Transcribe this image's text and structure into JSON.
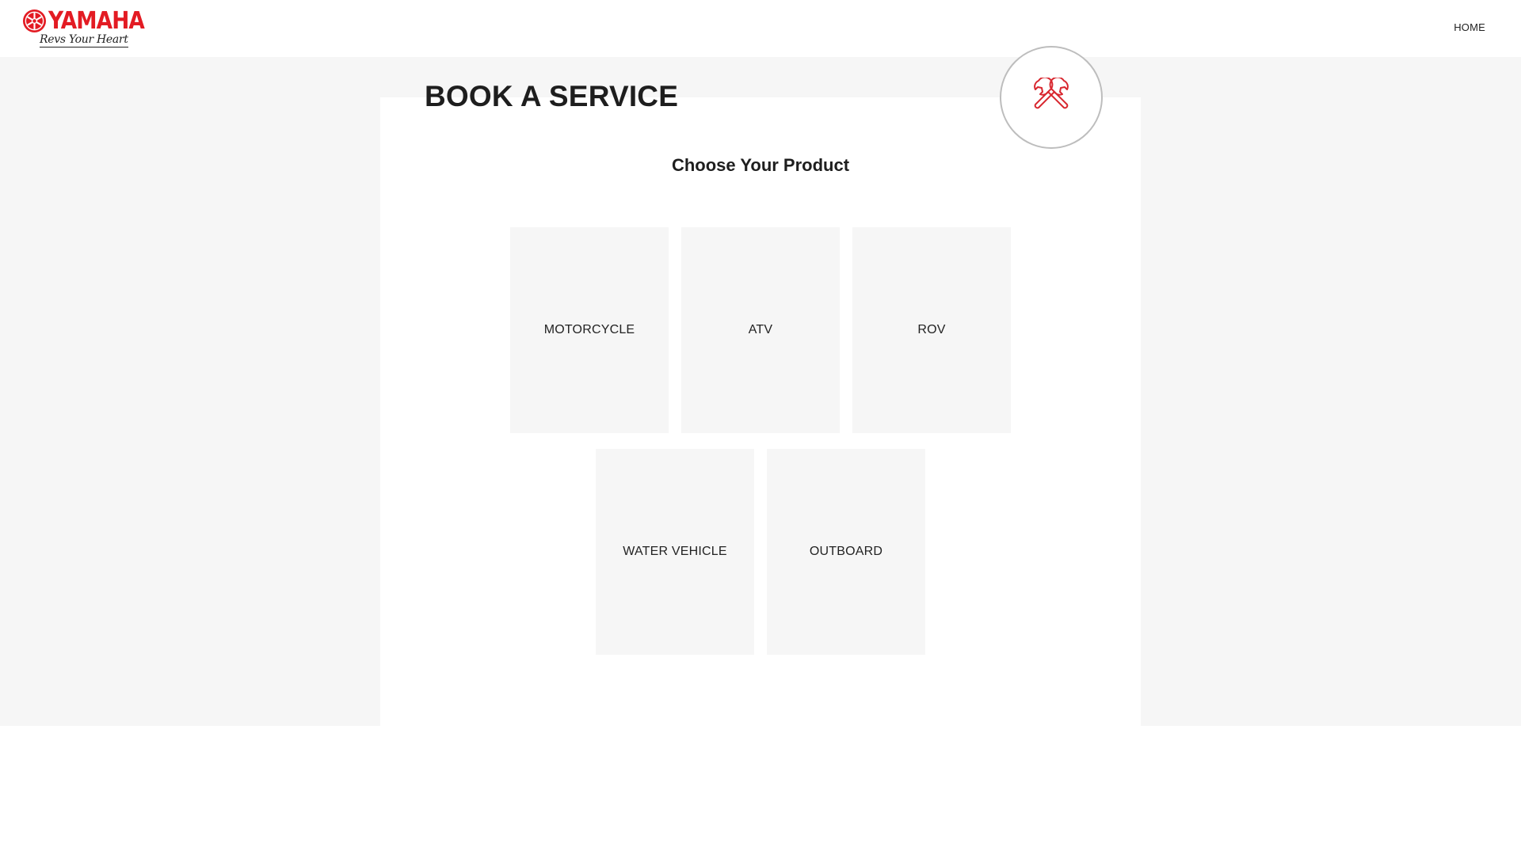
{
  "brand": {
    "name": "YAMAHA",
    "tagline": "Revs Your Heart",
    "color": "#e31b23"
  },
  "nav": {
    "home_label": "HOME"
  },
  "main": {
    "title": "BOOK A SERVICE",
    "subtitle": "Choose Your Product",
    "badge_icon": "wrench-cross-icon",
    "products": [
      {
        "label": "MOTORCYCLE"
      },
      {
        "label": "ATV"
      },
      {
        "label": "ROV"
      },
      {
        "label": "WATER VEHICLE"
      },
      {
        "label": "OUTBOARD"
      }
    ]
  }
}
